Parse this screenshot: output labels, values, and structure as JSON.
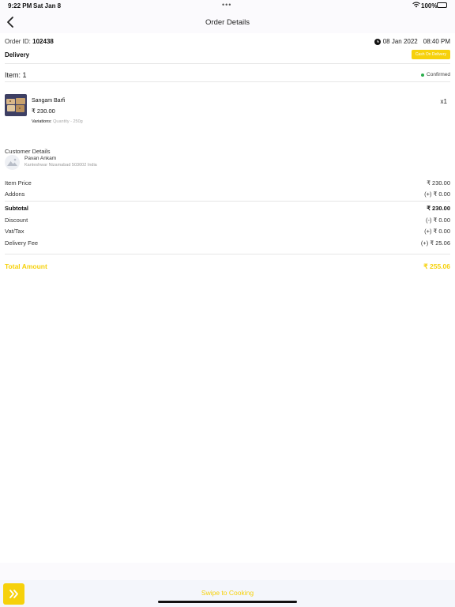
{
  "status_bar": {
    "time": "9:22 PM",
    "date": "Sat Jan 8",
    "dots": "•••",
    "battery": "100%"
  },
  "header": {
    "title": "Order Details",
    "back_icon": "chevron-left-icon"
  },
  "order": {
    "id_label": "Order ID:",
    "id_value": "102438",
    "date": "08 Jan 2022",
    "time": "08:40 PM",
    "type": "Delivery",
    "chip": "Cash On Delivery"
  },
  "items_section": {
    "count_label": "Item: 1",
    "status": "Confirmed"
  },
  "product": {
    "name": "Sangam Barfi",
    "quantity": "x1",
    "price": "₹ 230.00",
    "variations_label": "Variations:",
    "variations_value": "Quantity - 250g"
  },
  "customer": {
    "heading": "Customer Details",
    "name": "Pavan Ankam",
    "address": "Kanteshwar Nizamabad 503002 India"
  },
  "pricing": {
    "item_price_label": "Item Price",
    "item_price_value": "₹ 230.00",
    "addons_label": "Addons",
    "addons_value": "(+) ₹ 0.00",
    "subtotal_label": "Subtotal",
    "subtotal_value": "₹ 230.00",
    "discount_label": "Discount",
    "discount_value": "(-) ₹ 0.00",
    "vat_label": "Vat/Tax",
    "vat_value": "(+) ₹ 0.00",
    "delivery_label": "Delivery Fee",
    "delivery_value": "(+) ₹ 25.06",
    "total_label": "Total Amount",
    "total_value": "₹ 255.06"
  },
  "bottom": {
    "swipe_text": "Swipe to Cooking",
    "swipe_icon": "double-chevron-right-icon"
  },
  "colors": {
    "accent": "#f6d10b",
    "confirmed": "#2cae4d"
  }
}
